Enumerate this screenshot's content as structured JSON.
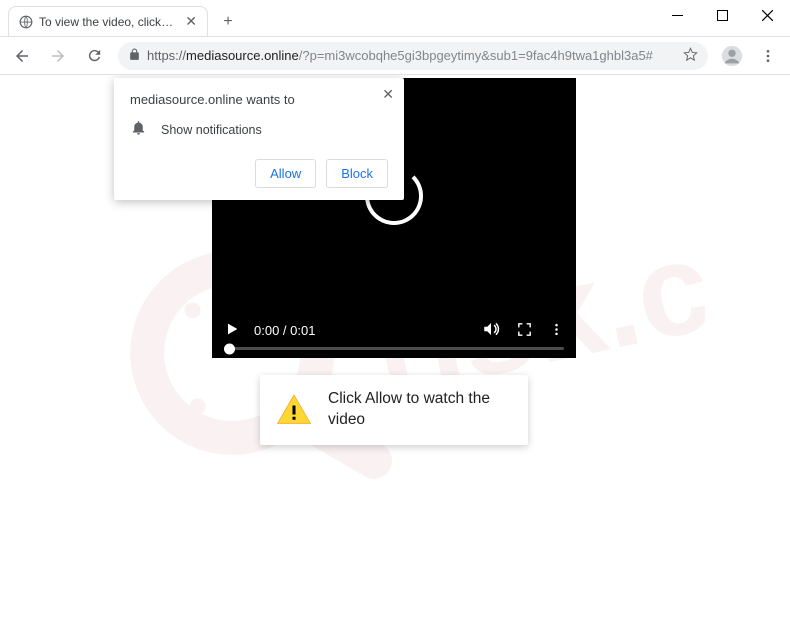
{
  "window": {
    "tab_title": "To view the video, click the Allow",
    "minimize": "—",
    "maximize": "□",
    "close": "✕"
  },
  "toolbar": {
    "url_scheme": "https://",
    "url_host": "mediasource.online",
    "url_path": "/?p=mi3wcobqhe5gi3bpgeytimy&sub1=9fac4h9twa1ghbl3a5#"
  },
  "notification": {
    "title": "mediasource.online wants to",
    "permission": "Show notifications",
    "allow": "Allow",
    "block": "Block"
  },
  "video": {
    "time_current": "0:00",
    "time_sep": " / ",
    "time_total": "0:01"
  },
  "hint": {
    "text": "Click Allow to watch the video"
  }
}
